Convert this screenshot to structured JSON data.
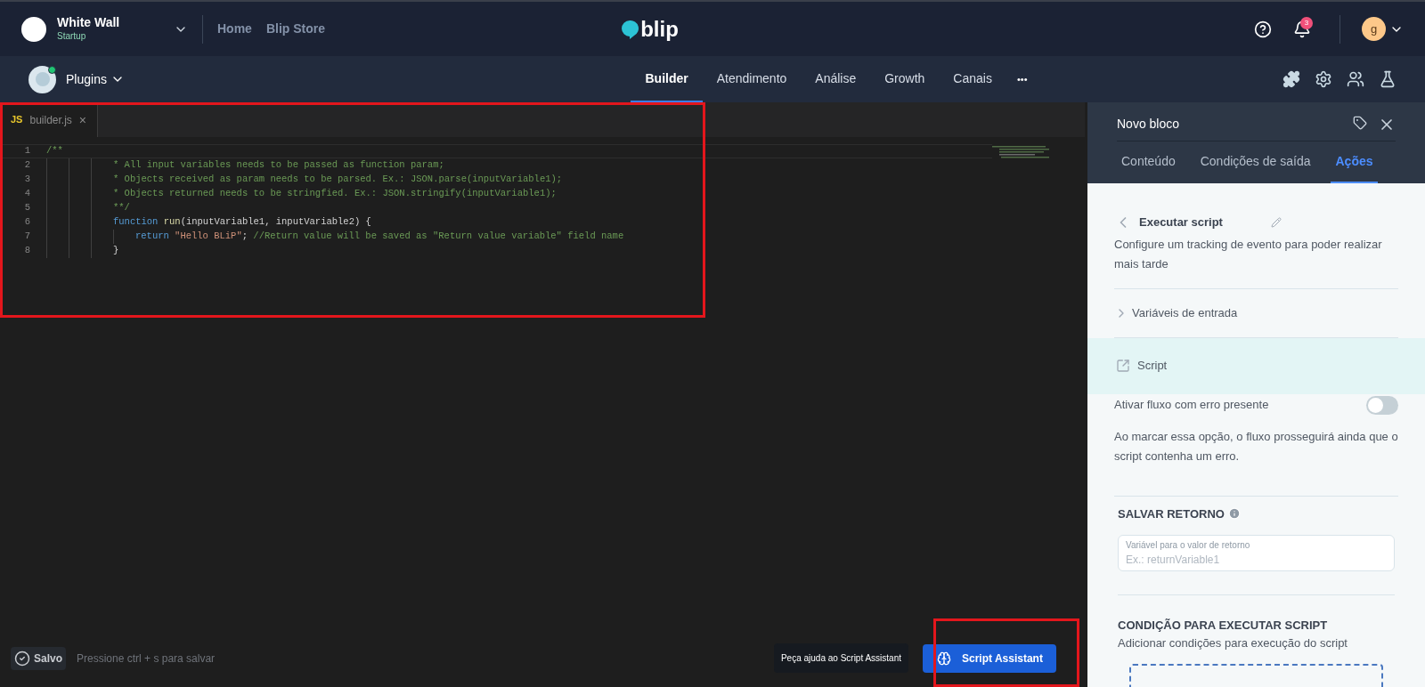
{
  "header": {
    "org": {
      "name": "White Wall",
      "plan": "Startup"
    },
    "links": [
      "Home",
      "Blip Store"
    ],
    "logo": "blip",
    "notifications": "3",
    "avatar": "g"
  },
  "nav": {
    "bot": {
      "name": "Plugins",
      "online": true
    },
    "tabs": [
      {
        "label": "Builder",
        "selected": true
      },
      {
        "label": "Atendimento",
        "selected": false
      },
      {
        "label": "Análise",
        "selected": false
      },
      {
        "label": "Growth",
        "selected": false
      },
      {
        "label": "Canais",
        "selected": false
      }
    ],
    "more": "•••"
  },
  "editor": {
    "file_tab": {
      "badge": "JS",
      "name": "builder.js",
      "close": "×"
    },
    "lines": [
      {
        "number": "1",
        "kind": "top",
        "tokens": [
          {
            "kind": "comment",
            "text": "/**"
          }
        ]
      },
      {
        "number": "2",
        "kind": "inner",
        "tokens": [
          {
            "kind": "comment",
            "text": "* All input variables needs to be passed as function param;"
          }
        ]
      },
      {
        "number": "3",
        "kind": "inner",
        "tokens": [
          {
            "kind": "comment",
            "text": "* Objects received as param needs to be parsed. Ex.: JSON.parse(inputVariable1);"
          }
        ]
      },
      {
        "number": "4",
        "kind": "inner",
        "tokens": [
          {
            "kind": "comment",
            "text": "* Objects returned needs to be stringfied. Ex.: JSON.stringify(inputVariable1);"
          }
        ]
      },
      {
        "number": "5",
        "kind": "inner",
        "tokens": [
          {
            "kind": "comment",
            "text": "**/"
          }
        ]
      },
      {
        "number": "6",
        "kind": "inner",
        "tokens": [
          {
            "kind": "keyword",
            "text": "function "
          },
          {
            "kind": "func",
            "text": "run"
          },
          {
            "kind": "plain",
            "text": "(inputVariable1, inputVariable2) {"
          }
        ]
      },
      {
        "number": "7",
        "kind": "nested",
        "tokens": [
          {
            "kind": "keyword",
            "text": "return "
          },
          {
            "kind": "string",
            "text": "\"Hello BLiP\""
          },
          {
            "kind": "plain",
            "text": "; "
          },
          {
            "kind": "comment",
            "text": "//Return value will be saved as \"Return value variable\" field name"
          }
        ]
      },
      {
        "number": "8",
        "kind": "inner",
        "tokens": [
          {
            "kind": "plain",
            "text": "}"
          }
        ]
      }
    ],
    "status": {
      "saved": "Salvo",
      "hint": "Pressione ctrl + s para salvar"
    },
    "tooltip": "Peça ajuda ao Script Assistant",
    "assistant_button": "Script Assistant"
  },
  "panel": {
    "title": "Novo bloco",
    "tabs": [
      {
        "label": "Conteúdo",
        "selected": false
      },
      {
        "label": "Condições de saída",
        "selected": false
      },
      {
        "label": "Ações",
        "selected": true
      }
    ],
    "action": {
      "title": "Executar script",
      "description": "Configure um tracking de evento para poder realizar mais tarde"
    },
    "inputs": {
      "label": "Variáveis de entrada",
      "expanded": false
    },
    "script": {
      "label": "Script"
    },
    "error_toggle": {
      "label": "Ativar fluxo com erro presente",
      "on": false,
      "description": "Ao marcar essa opção, o fluxo prosseguirá ainda que o script contenha um erro."
    },
    "save_return": {
      "heading": "SALVAR RETORNO",
      "field_label": "Variável para o valor de retorno",
      "placeholder": "Ex.: returnVariable1"
    },
    "condition": {
      "heading": "CONDIÇÃO PARA EXECUTAR SCRIPT",
      "description": "Adicionar condições para execução do script"
    }
  }
}
